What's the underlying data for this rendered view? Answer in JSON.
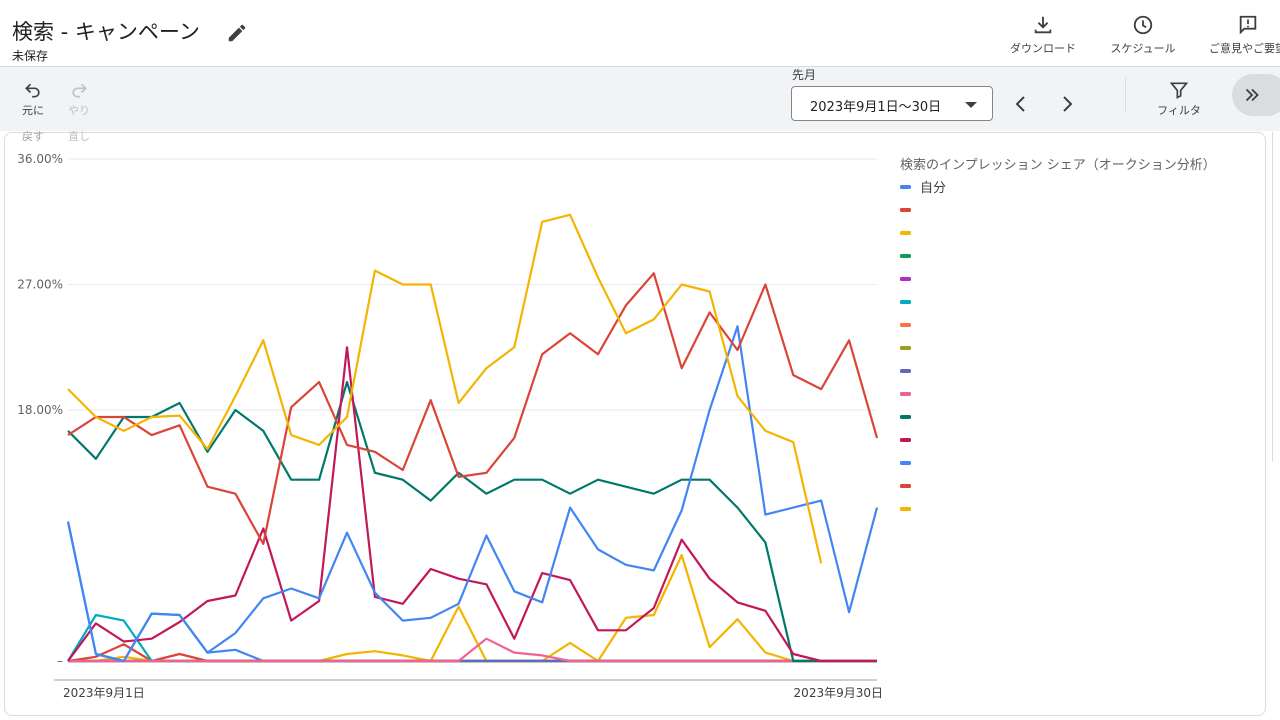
{
  "header": {
    "title": "検索 - キャンペーン",
    "subtitle": "未保存",
    "download_label": "ダウンロード",
    "schedule_label": "スケジュール",
    "feedback_label": "ご意見やご要望"
  },
  "toolbar": {
    "undo_label": "元に",
    "undo_label2": "戻す",
    "redo_label": "やり",
    "redo_label2": "直し",
    "period_label": "先月",
    "date_range": "2023年9月1日～30日",
    "filter_label": "フィルタ"
  },
  "chart_data": {
    "type": "line",
    "title": "",
    "ylim": [
      0,
      36
    ],
    "yticks": [
      "36.00%",
      "27.00%",
      "18.00%",
      "–"
    ],
    "x": [
      1,
      2,
      3,
      4,
      5,
      6,
      7,
      8,
      9,
      10,
      11,
      12,
      13,
      14,
      15,
      16,
      17,
      18,
      19,
      20,
      21,
      22,
      23,
      24,
      25,
      26,
      27,
      28,
      29,
      30
    ],
    "x_tick_labels": [
      "2023年9月1日",
      "2023年9月30日"
    ],
    "legend": {
      "title": "検索のインプレッション シェア（オークション分析）",
      "placement": "right"
    },
    "series": [
      {
        "name": "自分",
        "color": "#4285f4",
        "values": [
          10,
          0.5,
          0,
          3.4,
          3.3,
          0.6,
          0.8,
          0,
          0,
          0,
          0,
          0,
          0,
          0,
          0,
          0,
          0,
          0,
          0,
          0,
          0,
          0,
          0,
          0,
          0,
          0,
          0,
          0,
          0,
          0
        ]
      },
      {
        "name": "",
        "color": "#db4437",
        "values": [
          0,
          0.3,
          1.2,
          0,
          0.5,
          0,
          0,
          0,
          0,
          0,
          0,
          0,
          0,
          0,
          0,
          0,
          0,
          0,
          0,
          0,
          0,
          0,
          0,
          0,
          0,
          0,
          0,
          0,
          0,
          0
        ]
      },
      {
        "name": "",
        "color": "#f4b400",
        "values": [
          0,
          0,
          0.3,
          0,
          0,
          0,
          0,
          0,
          0,
          0,
          0.5,
          0.7,
          0.4,
          0,
          3.9,
          0,
          0,
          0,
          1.3,
          0,
          3.1,
          3.3,
          7.6,
          1,
          3,
          0.6,
          0,
          0,
          0,
          0
        ]
      },
      {
        "name": "",
        "color": "#0f9d58",
        "values": [
          0,
          0,
          0,
          0,
          0,
          0,
          0,
          0,
          0,
          0,
          0,
          0,
          0,
          0,
          0,
          0,
          0,
          0,
          0,
          0,
          0,
          0,
          0,
          0,
          0,
          0,
          0,
          0,
          0,
          0
        ]
      },
      {
        "name": "",
        "color": "#ab30c4",
        "values": [
          0,
          0,
          0,
          0,
          0,
          0,
          0,
          0,
          0,
          0,
          0,
          0,
          0,
          0,
          0,
          0,
          0,
          0,
          0,
          0,
          0,
          0,
          0,
          0,
          0,
          0,
          0,
          0,
          0,
          0
        ]
      },
      {
        "name": "",
        "color": "#00acc1",
        "values": [
          0,
          3.3,
          2.9,
          0,
          0,
          0,
          0,
          0,
          0,
          0,
          0,
          0,
          0,
          0,
          0,
          0,
          0,
          0,
          0,
          0,
          0,
          0,
          0,
          0,
          0,
          0,
          0,
          0,
          0,
          0
        ]
      },
      {
        "name": "",
        "color": "#ff7043",
        "values": [
          0,
          0,
          0,
          0,
          0,
          0,
          0,
          0,
          0,
          0,
          0,
          0,
          0,
          0,
          0,
          0,
          0,
          0,
          0,
          0,
          0,
          0,
          0,
          0,
          0,
          0,
          0,
          0,
          0,
          0
        ]
      },
      {
        "name": "",
        "color": "#9e9d24",
        "values": [
          0,
          0,
          0,
          0,
          0,
          0,
          0,
          0,
          0,
          0,
          0,
          0,
          0,
          0,
          0,
          0,
          0,
          0,
          0,
          0,
          0,
          0,
          0,
          0,
          0,
          0,
          0,
          0,
          0,
          0
        ]
      },
      {
        "name": "",
        "color": "#5c6bc0",
        "values": [
          0,
          0,
          0,
          0,
          0,
          0,
          0,
          0,
          0,
          0,
          0,
          0,
          0,
          0,
          0,
          0,
          0,
          0,
          0,
          0,
          0,
          0,
          0,
          0,
          0,
          0,
          0,
          0,
          0,
          0
        ]
      },
      {
        "name": "",
        "color": "#f06292",
        "values": [
          0,
          0,
          0,
          0,
          0,
          0,
          0,
          0,
          0,
          0,
          0,
          0,
          0,
          0,
          0,
          1.6,
          0.6,
          0.4,
          0,
          0,
          0,
          0,
          0,
          0,
          0,
          0,
          0,
          0,
          0,
          0
        ]
      },
      {
        "name": "",
        "color": "#00796b",
        "values": [
          16.5,
          14.5,
          17.5,
          17.5,
          18.5,
          15,
          18,
          16.5,
          13,
          13,
          20,
          13.5,
          13,
          11.5,
          13.5,
          12,
          13,
          13,
          12,
          13,
          12.5,
          12,
          13,
          13,
          11,
          8.5,
          0,
          0,
          0,
          0
        ]
      },
      {
        "name": "",
        "color": "#c2185b",
        "values": [
          0,
          2.7,
          1.4,
          1.6,
          2.8,
          4.3,
          4.7,
          9.5,
          2.9,
          4.3,
          22.5,
          4.6,
          4.1,
          6.6,
          5.9,
          5.5,
          1.6,
          6.3,
          5.8,
          2.2,
          2.2,
          3.8,
          8.7,
          5.9,
          4.2,
          3.6,
          0.5,
          0,
          0,
          0
        ]
      },
      {
        "name": "",
        "color": "#4285f4",
        "values": [
          10,
          0.5,
          0,
          3.4,
          3.3,
          0.6,
          2,
          4.5,
          5.2,
          4.5,
          9.2,
          4.9,
          2.9,
          3.1,
          4.1,
          9,
          5,
          4.2,
          11,
          8,
          6.9,
          6.5,
          10.8,
          18,
          24,
          10.5,
          11,
          11.5,
          3.5,
          11
        ]
      },
      {
        "name": "",
        "color": "#db4437",
        "values": [
          16.2,
          17.5,
          17.5,
          16.2,
          16.9,
          12.5,
          12,
          8.4,
          18.2,
          20,
          15.5,
          15,
          13.7,
          18.7,
          13.2,
          13.5,
          16,
          22,
          23.5,
          22,
          25.5,
          27.8,
          21,
          25,
          22.3,
          27,
          20.5,
          19.5,
          23,
          16
        ]
      },
      {
        "name": "",
        "color": "#f4b400",
        "values": [
          19.5,
          17.5,
          16.5,
          17.5,
          17.6,
          15.2,
          19,
          23,
          16.2,
          15.5,
          17.5,
          28,
          27,
          27,
          18.5,
          21,
          22.5,
          31.5,
          32,
          27.5,
          23.5,
          24.5,
          27,
          26.5,
          19,
          16.5,
          15.7,
          7
        ]
      }
    ]
  }
}
